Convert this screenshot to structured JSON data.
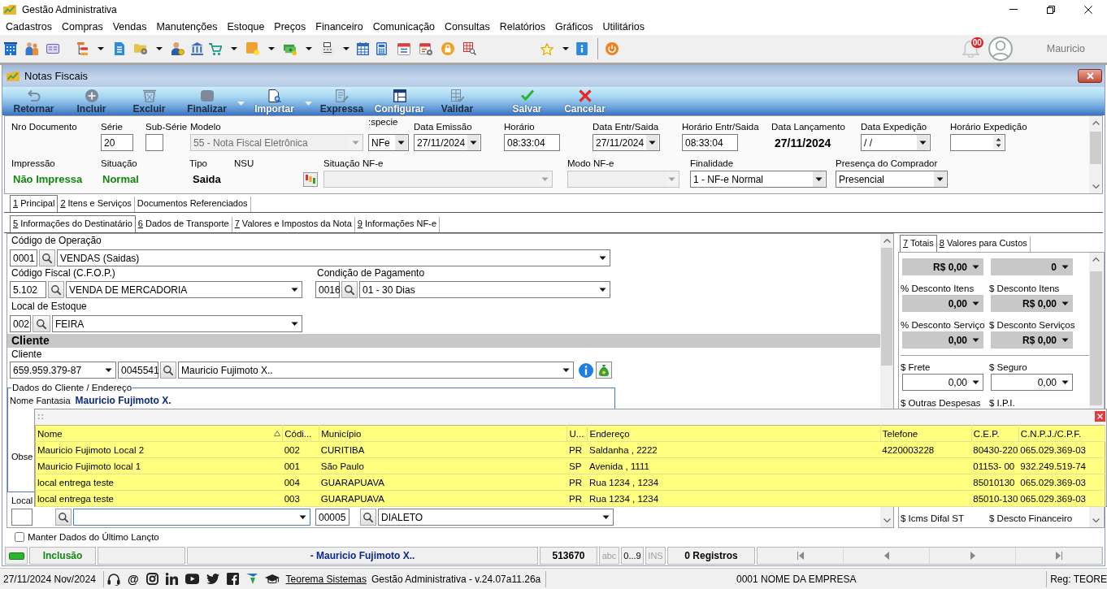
{
  "window": {
    "title": "Gestão Administrativa"
  },
  "menu": [
    "Cadastros",
    "Compras",
    "Vendas",
    "Manutenções",
    "Estoque",
    "Preços",
    "Financeiro",
    "Comunicação",
    "Consultas",
    "Relatórios",
    "Gráficos",
    "Utilitários"
  ],
  "user": {
    "notifications": "00",
    "name": "Mauricio"
  },
  "child_window": {
    "title": "Notas Fiscais"
  },
  "actions": [
    {
      "label": "Retornar",
      "disabled": true,
      "dropdown": false
    },
    {
      "label": "Incluir",
      "disabled": true,
      "dropdown": false
    },
    {
      "label": "Excluir",
      "disabled": true,
      "dropdown": false
    },
    {
      "label": "Finalizar",
      "disabled": true,
      "dropdown": true
    },
    {
      "label": "Importar",
      "disabled": false,
      "dropdown": true
    },
    {
      "label": "Expressa",
      "disabled": true,
      "dropdown": false
    },
    {
      "label": "Configurar",
      "disabled": false,
      "dropdown": false
    },
    {
      "label": "Validar",
      "disabled": true,
      "dropdown": false
    },
    {
      "label": "Salvar",
      "disabled": false,
      "dropdown": false
    },
    {
      "label": "Cancelar",
      "disabled": false,
      "dropdown": false
    }
  ],
  "header": {
    "row_1": [
      {
        "label": "Nro Documento",
        "kind": "empty"
      },
      {
        "label": "Série",
        "kind": "input",
        "value": "20",
        "disabled": false
      },
      {
        "label": "Sub-Série",
        "kind": "input",
        "disabled": false
      },
      {
        "label": "Modelo",
        "kind": "select",
        "value": "55 - Nota Fiscal Eletrônica",
        "disabled": true
      },
      {
        "label": ":specie",
        "kind": "select",
        "value": "NFe",
        "disabled": false
      },
      {
        "label": "Data Emissão",
        "kind": "select",
        "value": "27/11/2024",
        "disabled": false
      },
      {
        "label": "Horário",
        "kind": "input",
        "value": "08:33:04",
        "disabled": false
      },
      {
        "label": "Data Entr/Saida",
        "kind": "select",
        "value": "27/11/2024",
        "disabled": false
      },
      {
        "label": "Horário Entr/Saida",
        "kind": "input",
        "value": "08:33:04",
        "disabled": false
      },
      {
        "label": "Data Lançamento",
        "kind": "text",
        "value": "27/11/2024"
      },
      {
        "label": "Data Expedição",
        "kind": "select",
        "value": "/ /",
        "disabled": false
      },
      {
        "label": "Horário Expedição",
        "kind": "spinner",
        "disabled": false
      }
    ],
    "row_2": [
      {
        "label": "Impressão",
        "kind": "status",
        "value": "Não Impressa"
      },
      {
        "label": "Situação",
        "kind": "status",
        "value": "Normal"
      },
      {
        "label": "Tipo",
        "kind": "text",
        "value": "Saida"
      },
      {
        "label": "NSU",
        "kind": "button"
      },
      {
        "label": "Situação NF-e",
        "kind": "select",
        "disabled": true
      },
      {
        "label": "Modo NF-e",
        "kind": "select",
        "disabled": true
      },
      {
        "label": "Finalidade",
        "kind": "select",
        "value": "1 - NF-e Normal",
        "disabled": false
      },
      {
        "label": "Presença do Comprador",
        "kind": "select",
        "value": "Presencial",
        "disabled": false
      }
    ]
  },
  "tabs": [
    {
      "label": "1 Principal",
      "selected": true,
      "hotkey": true
    },
    {
      "label": "2 Itens e Serviços",
      "selected": false,
      "hotkey": true
    },
    {
      "label": "Documentos Referenciados",
      "selected": false,
      "hotkey": false
    }
  ],
  "subtabs": [
    {
      "label": "5 Informações do Destinatário",
      "selected": true,
      "hotkey": true
    },
    {
      "label": "6 Dados de Transporte",
      "selected": false,
      "hotkey": true
    },
    {
      "label": "7 Valores e Impostos da Nota",
      "selected": false,
      "hotkey": true
    },
    {
      "label": "9 Informações NF-e",
      "selected": false,
      "hotkey": true
    }
  ],
  "operation": {
    "label": "Código de Operação",
    "code": "0001",
    "value": "VENDAS (Saidas)"
  },
  "fiscal_code": {
    "label": "Código Fiscal (C.F.O.P.)",
    "code": "5.102",
    "value": "VENDA DE MERCADORIA"
  },
  "payment_terms": {
    "label": "Condição de Pagamento",
    "code": "0016",
    "value": "01 - 30 Dias"
  },
  "stock_location": {
    "label": "Local de Estoque",
    "code": "002",
    "value": "FEIRA"
  },
  "client": {
    "section_title": "Cliente",
    "label": "Cliente",
    "document": "659.959.379-87",
    "code": "0045541",
    "name": "Mauricio Fujimoto X.."
  },
  "client_details": {
    "title": "Dados do Cliente / Endereço",
    "trade_name_label": "Nome Fantasia",
    "trade_name": "Mauricio Fujimoto X.",
    "notes_label": "Obse"
  },
  "delivery": {
    "label": "Local",
    "code_2": "00005",
    "value_2": "DIALETO"
  },
  "keep_last_entry": {
    "label": "Manter Dados do Último Lançto",
    "checked": false
  },
  "totals": {
    "tabs": [
      {
        "label": "7 Totais",
        "selected": true,
        "hotkey": true
      },
      {
        "label": "8 Valores para Custos",
        "selected": false,
        "hotkey": true
      }
    ],
    "groups": [
      {
        "kind": "readonly",
        "rows": [
          [
            {
              "value": "R$ 0,00"
            },
            {
              "value": "0"
            }
          ],
          [
            {
              "label": "% Desconto Itens",
              "value": "0,00"
            },
            {
              "label": "$ Desconto Itens",
              "value": "R$ 0,00"
            }
          ],
          [
            {
              "label": "% Desconto Serviço",
              "value": "0,00"
            },
            {
              "label": "$ Desconto Serviços",
              "value": "R$ 0,00"
            }
          ]
        ]
      },
      {
        "kind": "input",
        "rows": [
          [
            {
              "label": "$ Frete",
              "value": "0,00"
            },
            {
              "label": "$ Seguro",
              "value": "0,00"
            }
          ],
          [
            {
              "label": "$ Outras Despesas"
            },
            {
              "label": "$ I.P.I."
            }
          ]
        ]
      }
    ],
    "bottom_row": [
      {
        "label": "$ Icms Difal ST"
      },
      {
        "label": "$ Descto Financeiro"
      }
    ]
  },
  "lookup": {
    "columns": [
      {
        "label": "Nome",
        "sorted": true
      },
      {
        "label": "Códi...",
        "sorted": false
      },
      {
        "label": "Município",
        "sorted": false
      },
      {
        "label": "U...",
        "sorted": false
      },
      {
        "label": "Endereço",
        "sorted": false
      },
      {
        "label": "Telefone",
        "sorted": false
      },
      {
        "label": "C.E.P.",
        "sorted": false
      },
      {
        "label": "C.N.P.J./C.P.F.",
        "sorted": false
      }
    ],
    "rows": [
      [
        "Mauricio Fujimoto Local 2",
        "002",
        "CURITIBA",
        "PR",
        "Saldanha , 2222",
        "4220003228",
        "80430-220",
        "065.029.369-03"
      ],
      [
        "Mauricio Fujimoto local 1",
        "001",
        "São Paulo",
        "SP",
        "Avenida , 1111",
        null,
        "01153- 00",
        "932.249.519-74"
      ],
      [
        "local entrega teste",
        "004",
        "GUARAPUAVA",
        "PR",
        "Rua 1234 , 1234",
        null,
        "85010130",
        "065.029.369-03"
      ],
      [
        "local entrega teste",
        "003",
        "GUARAPUAVA",
        "PR",
        "Rua 1234 , 1234",
        null,
        "85010-130",
        "065.029.369-03"
      ]
    ]
  },
  "status_bar": {
    "mode": "Inclusão",
    "record": "- Mauricio Fujimoto X..",
    "number": "513670",
    "indicators": [
      {
        "label": "abc",
        "active": false
      },
      {
        "label": "0...9",
        "active": true
      },
      {
        "label": "INS",
        "active": false
      }
    ],
    "records": "0 Registros"
  },
  "footer": {
    "date": "27/11/2024 Nov/2024",
    "at_sign": "@",
    "link": "Teorema Sistemas",
    "version": "Gestão Administrativa - v.24.07a11.26a",
    "company": "0001 NOME DA EMPRESA",
    "registration": "Reg: TEORE"
  }
}
